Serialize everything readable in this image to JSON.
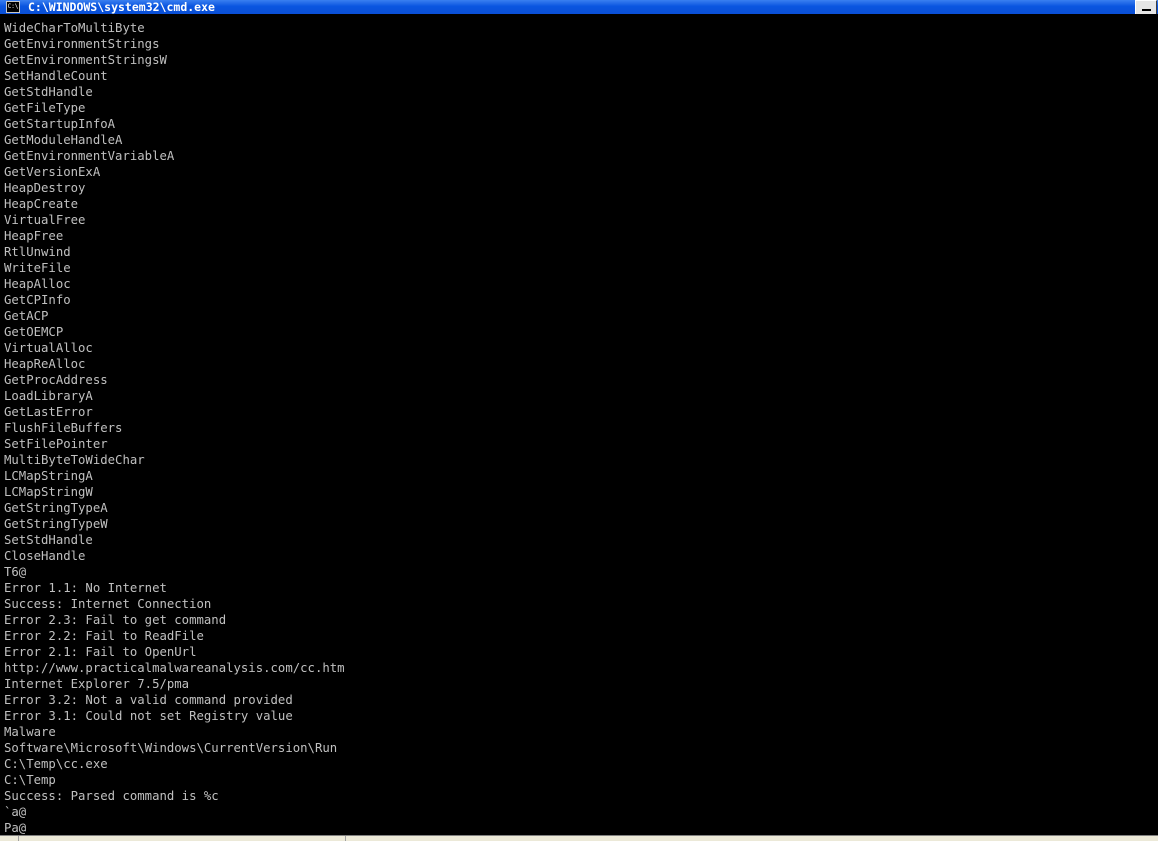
{
  "window": {
    "title": "C:\\WINDOWS\\system32\\cmd.exe",
    "icon": "cmd-icon",
    "icon_text": "C:\\"
  },
  "console": {
    "lines": [
      "WideCharToMultiByte",
      "GetEnvironmentStrings",
      "GetEnvironmentStringsW",
      "SetHandleCount",
      "GetStdHandle",
      "GetFileType",
      "GetStartupInfoA",
      "GetModuleHandleA",
      "GetEnvironmentVariableA",
      "GetVersionExA",
      "HeapDestroy",
      "HeapCreate",
      "VirtualFree",
      "HeapFree",
      "RtlUnwind",
      "WriteFile",
      "HeapAlloc",
      "GetCPInfo",
      "GetACP",
      "GetOEMCP",
      "VirtualAlloc",
      "HeapReAlloc",
      "GetProcAddress",
      "LoadLibraryA",
      "GetLastError",
      "FlushFileBuffers",
      "SetFilePointer",
      "MultiByteToWideChar",
      "LCMapStringA",
      "LCMapStringW",
      "GetStringTypeA",
      "GetStringTypeW",
      "SetStdHandle",
      "CloseHandle",
      "T6@",
      "Error 1.1: No Internet",
      "Success: Internet Connection",
      "Error 2.3: Fail to get command",
      "Error 2.2: Fail to ReadFile",
      "Error 2.1: Fail to OpenUrl",
      "http://www.practicalmalwareanalysis.com/cc.htm",
      "Internet Explorer 7.5/pma",
      "Error 3.2: Not a valid command provided",
      "Error 3.1: Could not set Registry value",
      "Malware",
      "Software\\Microsoft\\Windows\\CurrentVersion\\Run",
      "C:\\Temp\\cc.exe",
      "C:\\Temp",
      "Success: Parsed command is %c",
      "`a@",
      "Pa@"
    ]
  },
  "colors": {
    "background": "#000000",
    "text": "#c0c0c0",
    "titlebar": "#0a55e0"
  }
}
